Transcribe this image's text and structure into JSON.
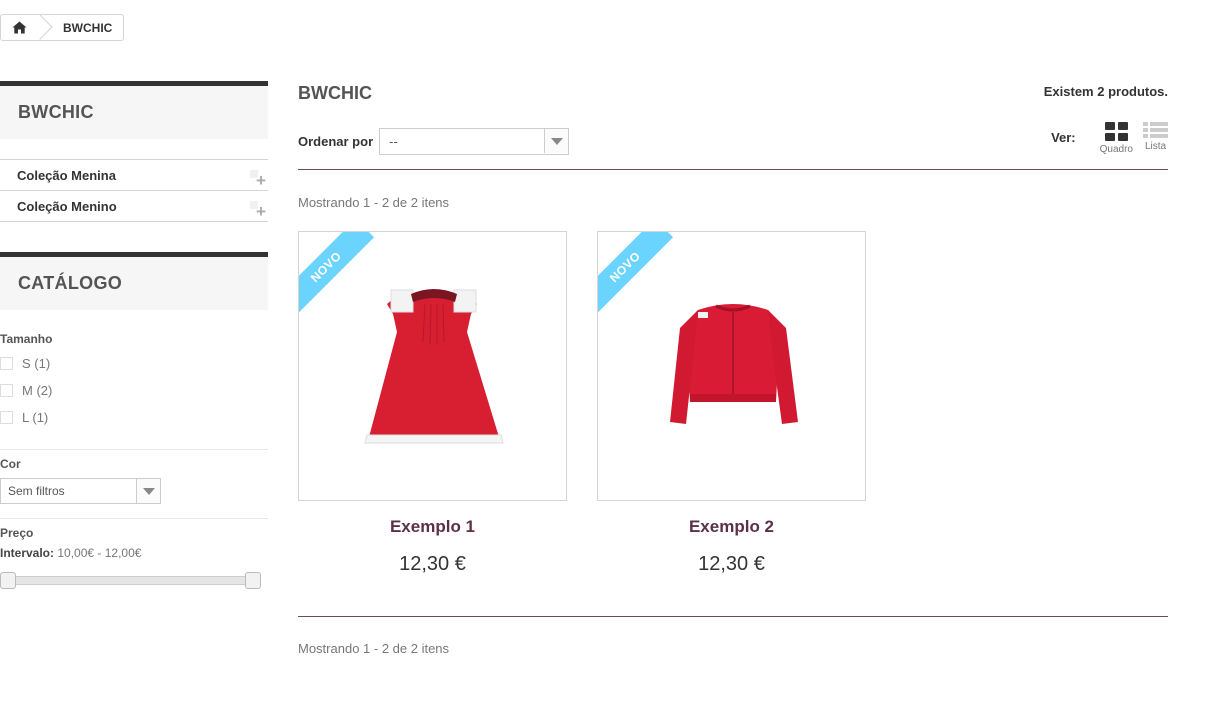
{
  "breadcrumb": {
    "home_icon": "home-icon",
    "current": "BWCHIC"
  },
  "sidebar": {
    "brand_title": "BWCHIC",
    "categories": [
      {
        "label": "Coleção Menina"
      },
      {
        "label": "Coleção Menino"
      }
    ],
    "catalog_title": "CATÁLOGO",
    "size_filter": {
      "label": "Tamanho",
      "options": [
        {
          "label": "S (1)"
        },
        {
          "label": "M (2)"
        },
        {
          "label": "L (1)"
        }
      ]
    },
    "color_filter": {
      "label": "Cor",
      "selected": "Sem filtros"
    },
    "price_filter": {
      "label": "Preço",
      "range_label": "Intervalo:",
      "range_value": "10,00€ - 12,00€",
      "range_fraction_low": 0.0,
      "range_fraction_high": 1.0
    }
  },
  "main": {
    "title": "BWCHIC",
    "count": "Existem 2 produtos.",
    "sort": {
      "label": "Ordenar por",
      "selected": "--"
    },
    "view": {
      "label": "Ver:",
      "grid_label": "Quadro",
      "list_label": "Lista",
      "active": "grid"
    },
    "showing_top": "Mostrando 1 - 2 de 2 itens",
    "showing_bottom": "Mostrando 1 - 2 de 2 itens",
    "products": [
      {
        "name": "Exemplo 1",
        "price": "12,30 €",
        "badge": "NOVO",
        "image": "red-dress"
      },
      {
        "name": "Exemplo 2",
        "price": "12,30 €",
        "badge": "NOVO",
        "image": "red-cardigan"
      }
    ]
  },
  "colors": {
    "accent_ribbon": "#6ad4ff",
    "product_name": "#5b3048",
    "rule": "#6f4a5a",
    "dark_bar": "#333333"
  }
}
